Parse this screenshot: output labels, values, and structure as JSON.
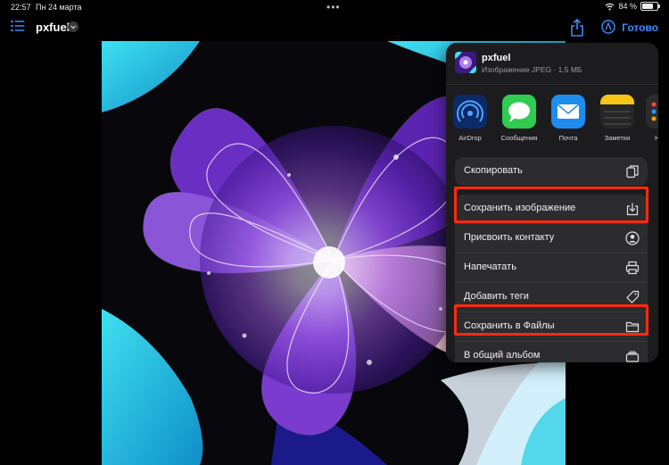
{
  "status": {
    "time": "22:57",
    "date": "Пн 24 марта",
    "battery": "84 %",
    "battery_level": 0.84
  },
  "nav": {
    "title": "pxfuel",
    "done_label": "Готово"
  },
  "sheet": {
    "title": "pxfuel",
    "subtitle": "Изображение JPEG · 1.5 МБ",
    "apps": [
      {
        "label": "AirDrop",
        "icon": "airdrop-icon"
      },
      {
        "label": "Сообщения",
        "icon": "messages-icon"
      },
      {
        "label": "Почта",
        "icon": "mail-icon"
      },
      {
        "label": "Заметки",
        "icon": "notes-icon"
      },
      {
        "label": "Напо",
        "icon": "reminders-icon"
      }
    ],
    "copy": {
      "label": "Скопировать",
      "icon": "copy-icon"
    },
    "actions": [
      {
        "label": "Сохранить изображение",
        "icon": "save-image-icon"
      },
      {
        "label": "Присвоить контакту",
        "icon": "contact-icon"
      },
      {
        "label": "Напечатать",
        "icon": "printer-icon"
      },
      {
        "label": "Добавить теги",
        "icon": "tag-icon"
      },
      {
        "label": "Сохранить в Файлы",
        "icon": "folder-icon"
      },
      {
        "label": "В общий альбом",
        "icon": "shared-album-icon"
      }
    ]
  },
  "colors": {
    "accent": "#3a8dff",
    "highlight": "#ff2a10",
    "sheet_bg": "#1c1c1e"
  }
}
